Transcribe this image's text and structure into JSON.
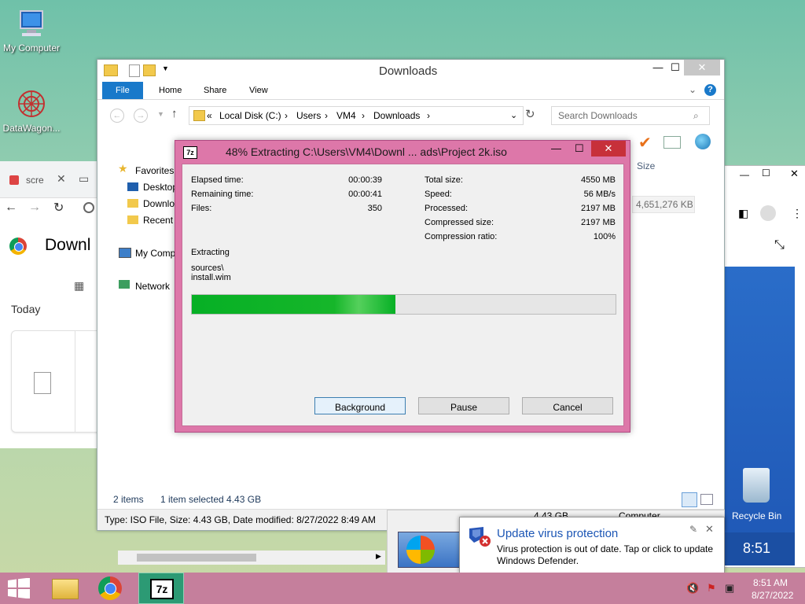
{
  "desktop": {
    "icons": [
      {
        "label": "My Computer"
      },
      {
        "label": "DataWagon..."
      },
      {
        "label": "Recycle Bin"
      }
    ]
  },
  "chrome_bg": {
    "tab_label": "scre",
    "heading": "Downl",
    "today": "Today"
  },
  "right_bg": {
    "clock": "8:51"
  },
  "explorer": {
    "title": "Downloads",
    "tabs": [
      "File",
      "Home",
      "Share",
      "View"
    ],
    "address": {
      "prefix": "«",
      "crumbs": [
        "Local Disk (C:)",
        "Users",
        "VM4",
        "Downloads"
      ]
    },
    "search_placeholder": "Search Downloads",
    "nav": {
      "favorites": "Favorites",
      "desktop": "Desktop",
      "downloads": "Downlo",
      "recent": "Recent p",
      "my_computer": "My Comp",
      "network": "Network"
    },
    "column_size": "Size",
    "file_size": "4,651,276 KB",
    "status": {
      "items": "2 items",
      "selected": "1 item selected  4.43 GB"
    },
    "details": "Type: ISO File, Size: 4.43 GB, Date modified: 8/27/2022 8:49 AM",
    "behind_size": "4.43 GB",
    "behind_computer": "Computer"
  },
  "dialog": {
    "title": "48% Extracting C:\\Users\\VM4\\Downl ... ads\\Project 2k.iso",
    "progress_fraction": 0.48,
    "left_stats": [
      {
        "label": "Elapsed time:",
        "value": "00:00:39"
      },
      {
        "label": "Remaining time:",
        "value": "00:00:41"
      },
      {
        "label": "Files:",
        "value": "350"
      }
    ],
    "right_stats": [
      {
        "label": "Total size:",
        "value": "4550 MB"
      },
      {
        "label": "Speed:",
        "value": "56 MB/s"
      },
      {
        "label": "Processed:",
        "value": "2197 MB"
      },
      {
        "label": "Compressed size:",
        "value": "2197 MB"
      },
      {
        "label": "Compression ratio:",
        "value": "100%"
      }
    ],
    "action": "Extracting",
    "path_line1": "sources\\",
    "path_line2": "install.wim",
    "buttons": {
      "background": "Background",
      "pause": "Pause",
      "cancel": "Cancel"
    },
    "app_icon": "7z"
  },
  "notification": {
    "title": "Update virus protection",
    "body_line1": "Virus protection is out of date. Tap or click to update",
    "body_line2": "Windows Defender."
  },
  "taskbar": {
    "time": "8:51 AM",
    "date": "8/27/2022",
    "sevenzip_label": "7z"
  },
  "colors": {
    "accent": "#1979ca",
    "dialog_frame": "#dd77a9",
    "progress": "#1db32b",
    "taskbar": "#c57f9c"
  }
}
